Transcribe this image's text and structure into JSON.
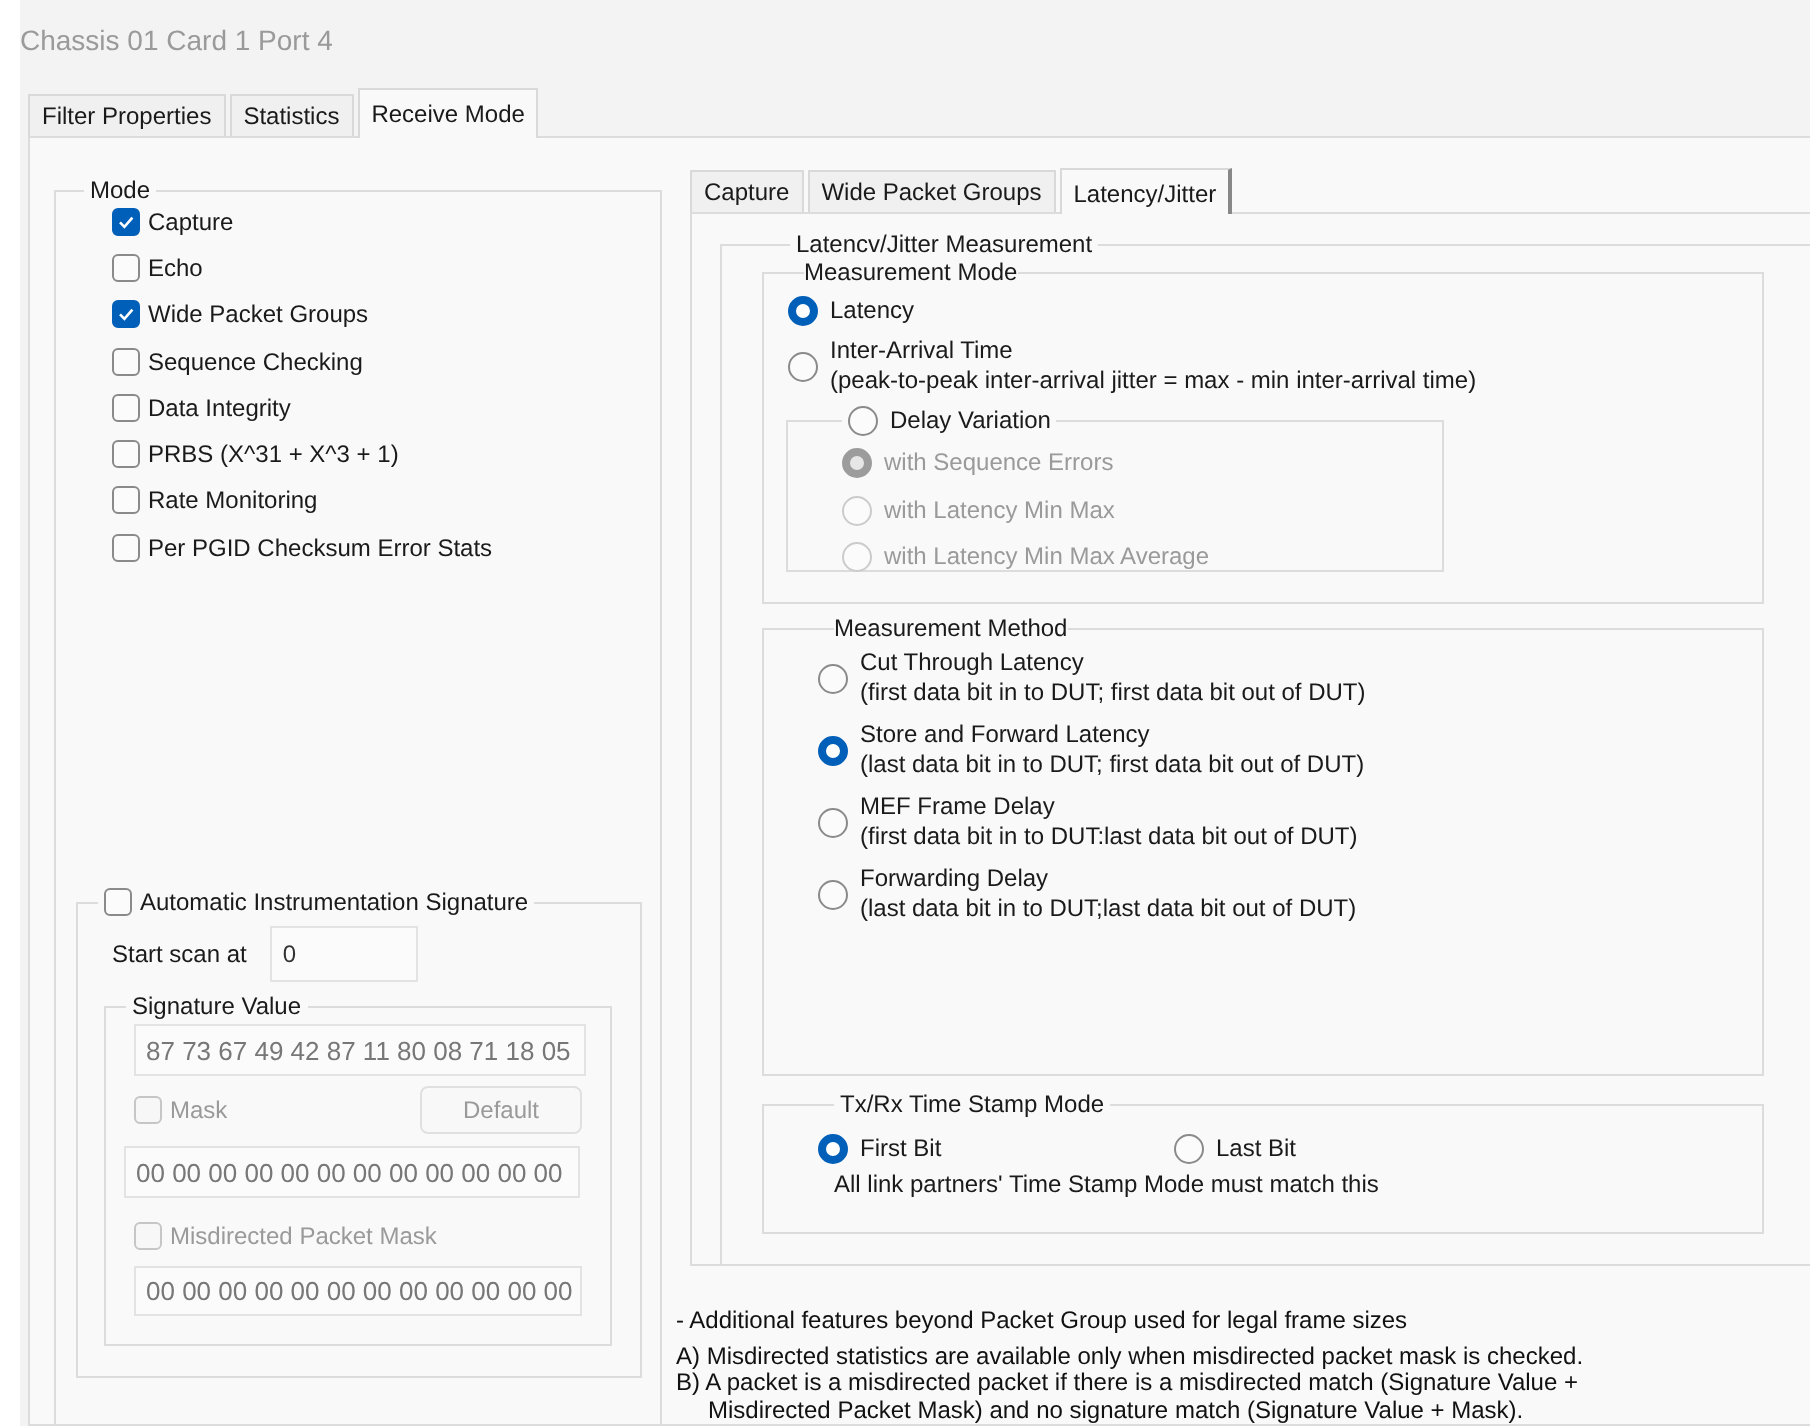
{
  "window": {
    "title": "Chassis 01 Card 1 Port 4"
  },
  "tabs": [
    {
      "label": "Filter Properties",
      "selected": false
    },
    {
      "label": "Statistics",
      "selected": false
    },
    {
      "label": "Receive Mode",
      "selected": true
    }
  ],
  "mode": {
    "title": "Mode",
    "options": [
      {
        "label": "Capture",
        "checked": true
      },
      {
        "label": "Echo",
        "checked": false
      },
      {
        "label": "Wide Packet Groups",
        "checked": true
      },
      {
        "label": "Sequence Checking",
        "checked": false
      },
      {
        "label": "Data Integrity",
        "checked": false
      },
      {
        "label": "PRBS (X^31 + X^3 + 1)",
        "checked": false
      },
      {
        "label": "Rate Monitoring",
        "checked": false
      },
      {
        "label": "Per PGID Checksum Error Stats",
        "checked": false
      }
    ]
  },
  "signature": {
    "label": "Automatic Instrumentation Signature",
    "checked": false,
    "start_scan_label": "Start scan at",
    "start_scan_value": "0",
    "value_group": {
      "title": "Signature Value",
      "value": "87 73 67 49 42 87 11 80 08 71 18 05",
      "mask": {
        "label": "Mask",
        "checked": false,
        "disabled": true
      },
      "default_button": {
        "label": "Default",
        "disabled": true
      },
      "mask_value": "00 00 00 00 00 00 00 00 00 00 00 00",
      "misdirected_mask": {
        "label": "Misdirected Packet Mask",
        "checked": false,
        "disabled": true
      },
      "misdirected_value": "00 00 00 00 00 00 00 00 00 00 00 00"
    }
  },
  "sub_tabs": [
    {
      "label": "Capture",
      "selected": false
    },
    {
      "label": "Wide Packet Groups",
      "selected": false
    },
    {
      "label": "Latency/Jitter",
      "selected": true
    }
  ],
  "latency_jitter": {
    "title": "Latencv/Jitter Measurement",
    "measurement_mode": {
      "title": "Measurement Mode",
      "options": [
        {
          "label": "Latency",
          "selected": true
        },
        {
          "label": "Inter-Arrival Time",
          "detail": "(peak-to-peak inter-arrival jitter = max - min inter-arrival time)",
          "selected": false
        },
        {
          "label": "Delay Variation",
          "selected": false,
          "suboptions": [
            {
              "label": "with Sequence Errors",
              "selected": true,
              "disabled": true
            },
            {
              "label": "with Latency Min Max",
              "selected": false,
              "disabled": true
            },
            {
              "label": "with Latency Min Max Average",
              "selected": false,
              "disabled": true
            }
          ]
        }
      ]
    },
    "measurement_method": {
      "title": "Measurement Method",
      "options": [
        {
          "label": "Cut Through Latency",
          "detail": "(first data bit in to DUT; first data bit out of DUT)",
          "selected": false
        },
        {
          "label": "Store and Forward Latency",
          "detail": "(last data bit in to DUT; first data bit out of DUT)",
          "selected": true
        },
        {
          "label": "MEF Frame Delay",
          "detail": "(first data bit in to DUT:last data bit out of DUT)",
          "selected": false
        },
        {
          "label": "Forwarding Delay",
          "detail": "(last data bit in to DUT;last data bit out of DUT)",
          "selected": false
        }
      ]
    },
    "timestamp": {
      "title": "Tx/Rx Time Stamp Mode",
      "options": [
        {
          "label": "First Bit",
          "selected": true
        },
        {
          "label": "Last Bit",
          "selected": false
        }
      ],
      "note": "All link partners' Time Stamp Mode must match this"
    }
  },
  "notes": [
    "- Additional features beyond Packet Group used for legal frame sizes",
    "A)  Misdirected statistics are available only when misdirected packet mask is checked.",
    "B)  A packet is a misdirected packet if there is a misdirected match (Signature Value + Misdirected Packet Mask) and no signature match (Signature Value + Mask)."
  ]
}
